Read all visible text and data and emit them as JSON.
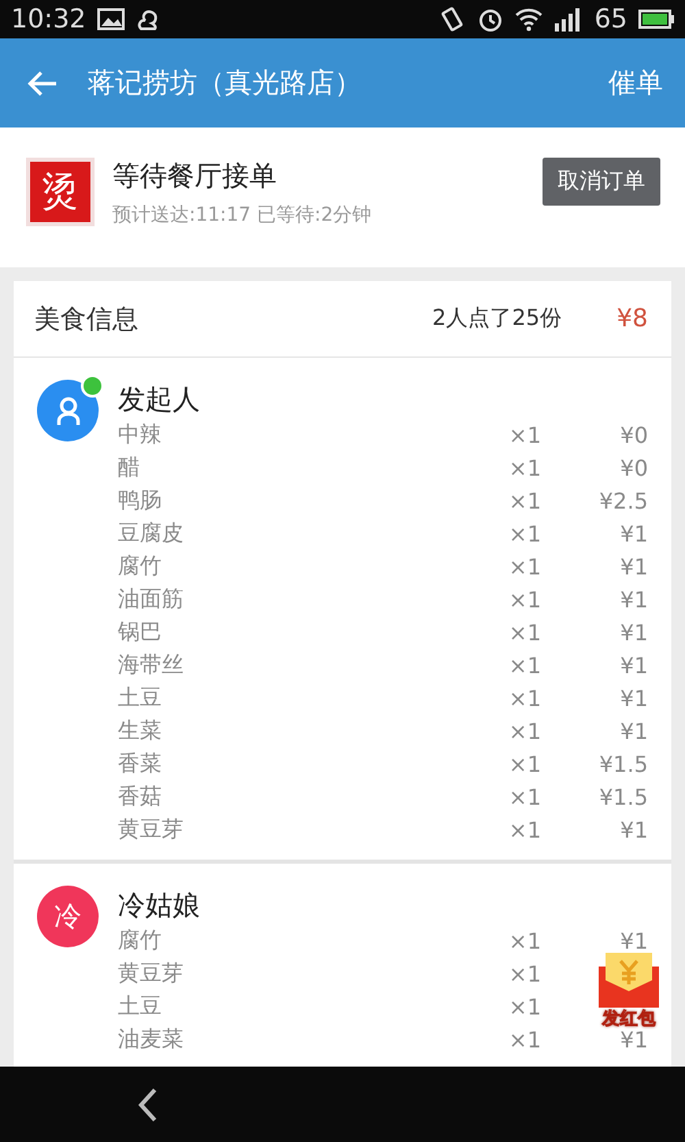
{
  "status_bar": {
    "time": "10:32",
    "battery_level": "65"
  },
  "app_bar": {
    "title": "蒋记捞坊（真光路店）",
    "action": "催单"
  },
  "order": {
    "logo_char": "烫",
    "status": "等待餐厅接单",
    "detail": "预计送达:11:17 已等待:2分钟",
    "cancel_button": "取消订单"
  },
  "food_info": {
    "title": "美食信息",
    "summary": "2人点了25份",
    "total": "¥8",
    "groups": [
      {
        "name": "发起人",
        "avatar": {
          "kind": "person",
          "color": "#2a8ef0"
        },
        "items": [
          {
            "name": "中辣",
            "qty": "×1",
            "price": "¥0"
          },
          {
            "name": "醋",
            "qty": "×1",
            "price": "¥0"
          },
          {
            "name": "鸭肠",
            "qty": "×1",
            "price": "¥2.5"
          },
          {
            "name": "豆腐皮",
            "qty": "×1",
            "price": "¥1"
          },
          {
            "name": "腐竹",
            "qty": "×1",
            "price": "¥1"
          },
          {
            "name": "油面筋",
            "qty": "×1",
            "price": "¥1"
          },
          {
            "name": "锅巴",
            "qty": "×1",
            "price": "¥1"
          },
          {
            "name": "海带丝",
            "qty": "×1",
            "price": "¥1"
          },
          {
            "name": "土豆",
            "qty": "×1",
            "price": "¥1"
          },
          {
            "name": "生菜",
            "qty": "×1",
            "price": "¥1"
          },
          {
            "name": "香菜",
            "qty": "×1",
            "price": "¥1.5"
          },
          {
            "name": "香菇",
            "qty": "×1",
            "price": "¥1.5"
          },
          {
            "name": "黄豆芽",
            "qty": "×1",
            "price": "¥1"
          }
        ]
      },
      {
        "name": "冷姑娘",
        "avatar": {
          "kind": "letter",
          "text": "冷",
          "color": "#f0365a"
        },
        "items": [
          {
            "name": "腐竹",
            "qty": "×1",
            "price": "¥1"
          },
          {
            "name": "黄豆芽",
            "qty": "×1"
          },
          {
            "name": "土豆",
            "qty": "×1"
          },
          {
            "name": "油麦菜",
            "qty": "×1",
            "price": "¥1"
          }
        ]
      }
    ]
  },
  "red_packet": {
    "label": "发红包"
  }
}
